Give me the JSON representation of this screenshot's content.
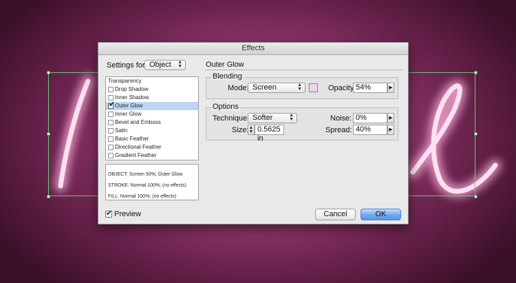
{
  "dialog": {
    "title": "Effects",
    "settings_for_label": "Settings for:",
    "settings_for_value": "Object",
    "effects_list": [
      {
        "label": "Transparency",
        "checked": false,
        "has_checkbox": false,
        "selected": false
      },
      {
        "label": "Drop Shadow",
        "checked": false,
        "has_checkbox": true,
        "selected": false
      },
      {
        "label": "Inner Shadow",
        "checked": false,
        "has_checkbox": true,
        "selected": false
      },
      {
        "label": "Outer Glow",
        "checked": true,
        "has_checkbox": true,
        "selected": true
      },
      {
        "label": "Inner Glow",
        "checked": false,
        "has_checkbox": true,
        "selected": false
      },
      {
        "label": "Bevel and Emboss",
        "checked": false,
        "has_checkbox": true,
        "selected": false
      },
      {
        "label": "Satin",
        "checked": false,
        "has_checkbox": true,
        "selected": false
      },
      {
        "label": "Basic Feather",
        "checked": false,
        "has_checkbox": true,
        "selected": false
      },
      {
        "label": "Directional Feather",
        "checked": false,
        "has_checkbox": true,
        "selected": false
      },
      {
        "label": "Gradient Feather",
        "checked": false,
        "has_checkbox": true,
        "selected": false
      }
    ],
    "summary_lines": [
      "OBJECT: Screen 50%; Outer Glow",
      "STROKE: Normal 100%; (no effects)",
      "FILL: Normal 100%; (no effects)"
    ],
    "panel_title": "Outer Glow",
    "blending": {
      "group_label": "Blending",
      "mode_label": "Mode:",
      "mode_value": "Screen",
      "glow_color": "#efd3ec",
      "opacity_label": "Opacity:",
      "opacity_value": "54%"
    },
    "options": {
      "group_label": "Options",
      "technique_label": "Technique:",
      "technique_value": "Softer",
      "size_label": "Size:",
      "size_value": "0.5625 in",
      "noise_label": "Noise:",
      "noise_value": "0%",
      "spread_label": "Spread:",
      "spread_value": "40%"
    },
    "preview_label": "Preview",
    "preview_checked": true,
    "cancel_label": "Cancel",
    "ok_label": "OK"
  },
  "colors": {
    "background": "#9a3d72",
    "neon_glow": "#f7c7e6",
    "selection": "#6cc97a",
    "ok_button": "#6fa8ec"
  }
}
